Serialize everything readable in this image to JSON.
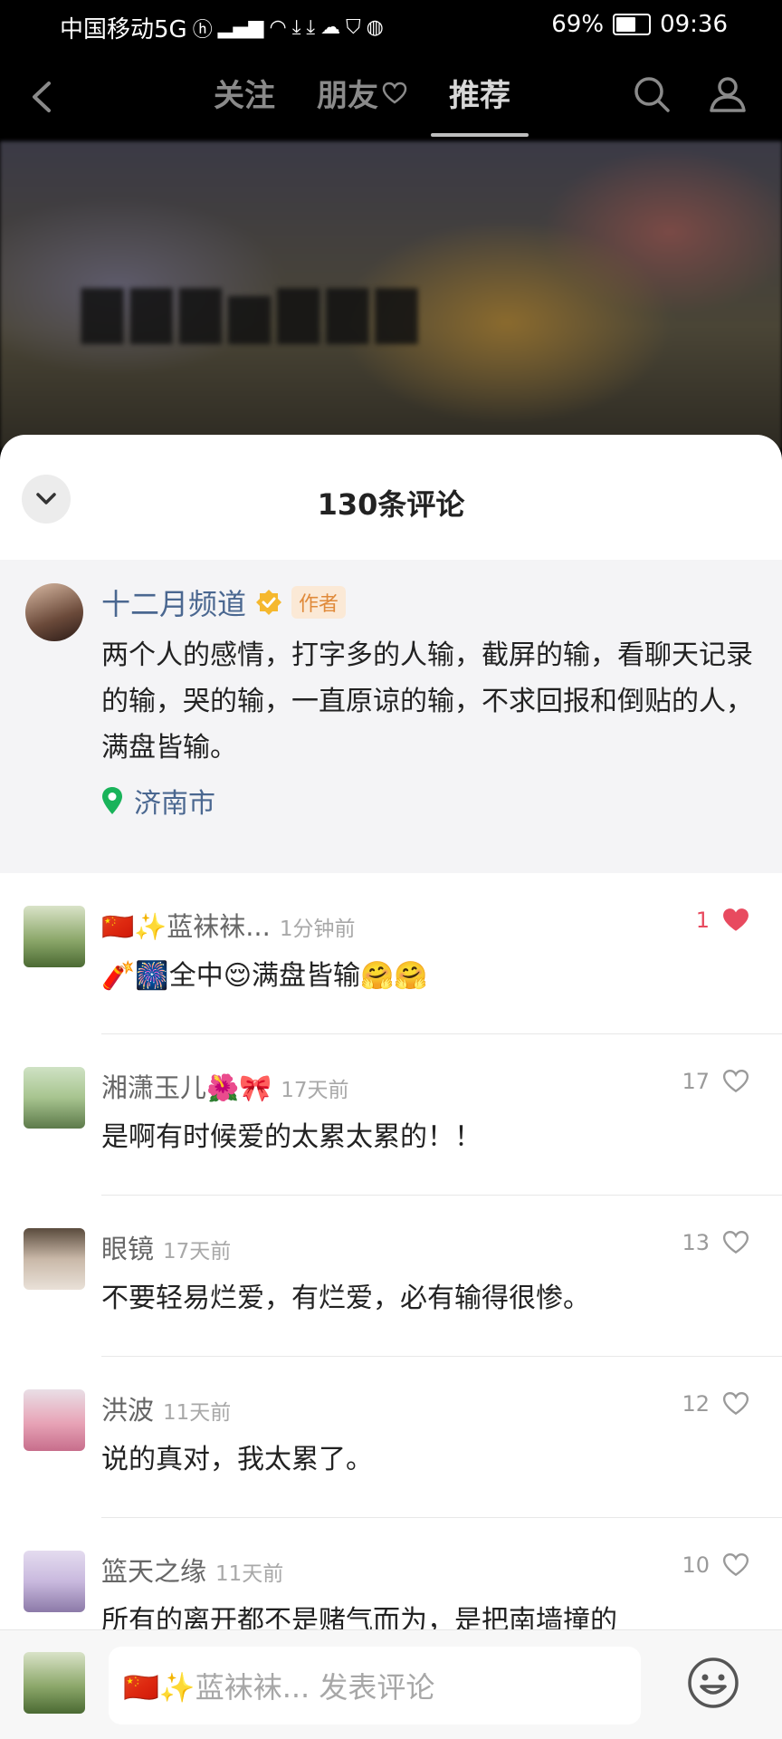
{
  "status_bar": {
    "carrier": "中国移动5G",
    "battery": "69%",
    "battery_level": 0.69,
    "time": "09:36"
  },
  "top_nav": {
    "tabs": [
      {
        "label": "关注"
      },
      {
        "label": "朋友"
      },
      {
        "label": "推荐"
      }
    ],
    "active_tab": "推荐"
  },
  "comments_sheet": {
    "title": "130条评论",
    "author_post": {
      "name": "十二月频道",
      "tag": "作者",
      "text": "两个人的感情，打字多的人输，截屏的输，看聊天记录的输，哭的输，一直原谅的输，不求回报和倒贴的人，满盘皆输。",
      "location": "济南市"
    },
    "comments": [
      {
        "name": "🇨🇳✨蓝袜袜...",
        "time": "1分钟前",
        "text": "🧨🎆全中😌满盘皆输🤗🤗",
        "likes": "1",
        "liked": true
      },
      {
        "name": "湘潇玉儿🌺🎀",
        "time": "17天前",
        "text": "是啊有时候爱的太累太累的！！",
        "likes": "17",
        "liked": false
      },
      {
        "name": "眼镜",
        "time": "17天前",
        "text": "不要轻易烂爱，有烂爱，必有输得很惨。",
        "likes": "13",
        "liked": false
      },
      {
        "name": "洪波",
        "time": "11天前",
        "text": "说的真对，我太累了。",
        "likes": "12",
        "liked": false
      },
      {
        "name": "篮天之缘",
        "time": "11天前",
        "text": "所有的离开都不是赌气而为，是把南墙撞的",
        "likes": "10",
        "liked": false
      }
    ]
  },
  "bottom_bar": {
    "input_placeholder": "🇨🇳✨蓝袜袜... 发表评论"
  },
  "colors": {
    "accent_like": "#e84a5f",
    "name_blue": "#4a6790",
    "location_green": "#19b35a"
  }
}
